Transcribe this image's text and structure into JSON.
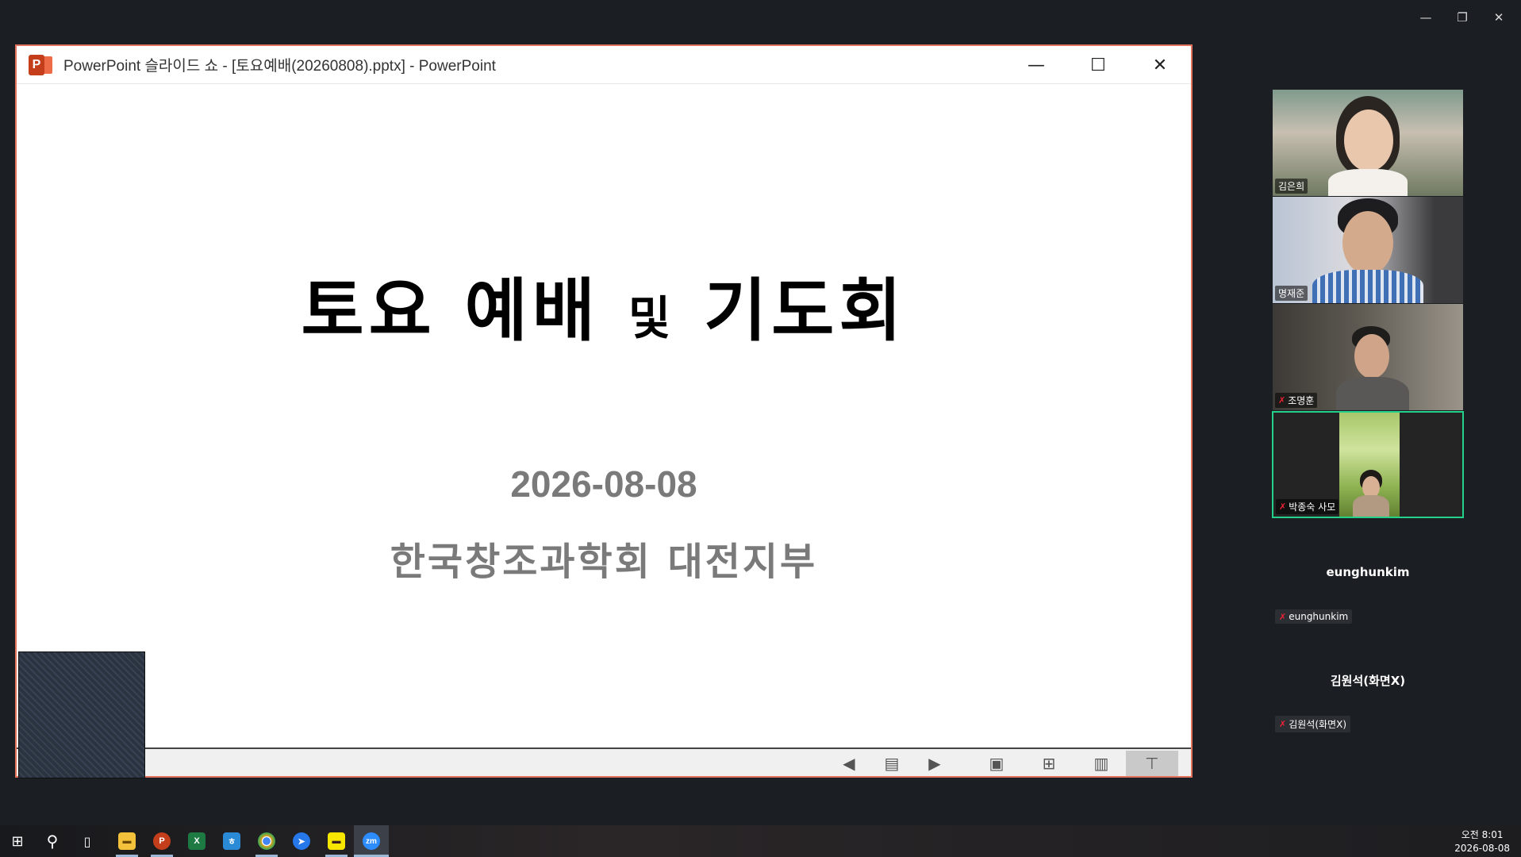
{
  "zoom_window": {
    "controls": [
      "—",
      "❐",
      "✕"
    ]
  },
  "ppt": {
    "title": "PowerPoint 슬라이드 쇼  -  [토요예배(20260808).pptx]  -  PowerPoint",
    "logo_letter": "P",
    "win_buttons": [
      "—",
      "☐",
      "✕"
    ],
    "slide": {
      "title_part1": "토요 예배",
      "title_small": "및",
      "title_part2": "기도회",
      "date": "2026-08-08",
      "organization": "한국창조과학회 대전지부"
    },
    "bottom_bar": {
      "icons": [
        "previous-icon",
        "notes-icon",
        "next-icon",
        "normal-view-icon",
        "slide-sorter-icon",
        "reading-view-icon",
        "slideshow-icon"
      ],
      "glyphs": [
        "◀",
        "▤",
        "▶",
        "▣",
        "⊞",
        "▥",
        "⊤"
      ]
    }
  },
  "participants": {
    "tiles": [
      {
        "name": "김은희",
        "muted": false
      },
      {
        "name": "명재준",
        "muted": false
      },
      {
        "name": "조명훈",
        "muted": true
      },
      {
        "name": "박종숙 사모",
        "muted": true
      }
    ],
    "no_video": [
      {
        "display": "eunghunkim",
        "tag": "eunghunkim",
        "muted": true
      },
      {
        "display": "김원석(화면X)",
        "tag": "김원석(화면X)",
        "muted": true
      }
    ],
    "muted_glyph": "🎤̸",
    "active_speaker_color": "#23d18b"
  },
  "taskbar": {
    "apps": [
      {
        "name": "start-button",
        "glyph": "⊞"
      },
      {
        "name": "search-button",
        "glyph": "⚲"
      },
      {
        "name": "task-view-button",
        "glyph": "▯"
      },
      {
        "name": "file-explorer-app",
        "glyph": "▬",
        "color": "#f3c13a"
      },
      {
        "name": "powerpoint-app",
        "glyph": "P",
        "color": "#c43e1c"
      },
      {
        "name": "excel-app",
        "glyph": "X",
        "color": "#1d7a43"
      },
      {
        "name": "hancom-app",
        "glyph": "ㅎ",
        "color": "#2a8ad6"
      },
      {
        "name": "chrome-app",
        "glyph": "●",
        "color": "#e0a021"
      },
      {
        "name": "direction-app",
        "glyph": "➤",
        "color": "#2677ea"
      },
      {
        "name": "kakaotalk-app",
        "glyph": "▬",
        "color": "#f7e600"
      },
      {
        "name": "zoom-app",
        "glyph": "zm",
        "color": "#2d8cff"
      }
    ],
    "clock": {
      "time": "오전 8:01",
      "date": "2026-08-08"
    }
  }
}
